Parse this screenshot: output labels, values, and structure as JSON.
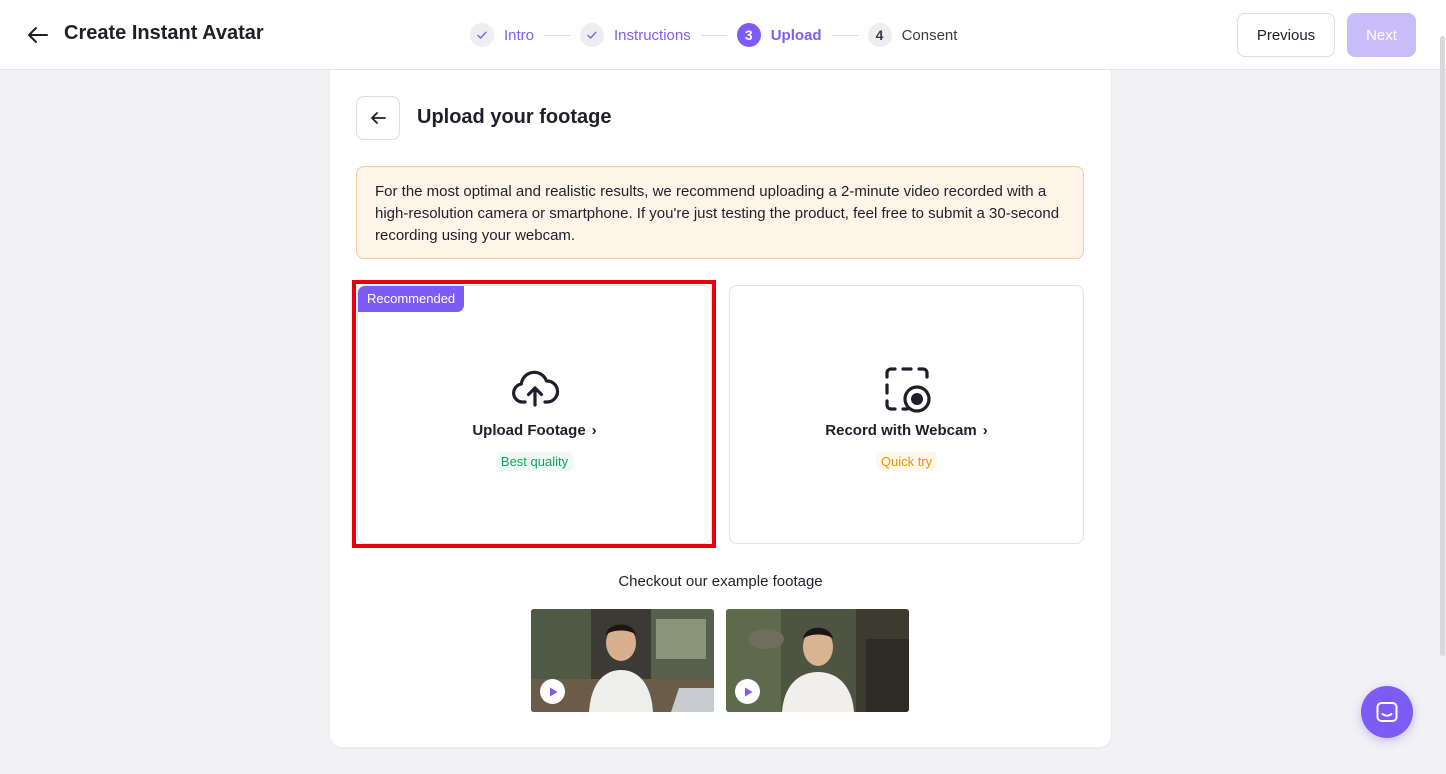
{
  "header": {
    "title": "Create Instant Avatar",
    "steps": [
      {
        "number": "1",
        "label": "Intro",
        "state": "done"
      },
      {
        "number": "2",
        "label": "Instructions",
        "state": "done"
      },
      {
        "number": "3",
        "label": "Upload",
        "state": "active"
      },
      {
        "number": "4",
        "label": "Consent",
        "state": "todo"
      }
    ],
    "previous_label": "Previous",
    "next_label": "Next"
  },
  "main": {
    "title": "Upload your footage",
    "notice": "For the most optimal and realistic results, we recommend uploading a 2-minute video recorded with a high-resolution camera or smartphone. If you're just testing the product, feel free to submit a 30-second recording using your webcam.",
    "options": [
      {
        "badge": "Recommended",
        "title": "Upload Footage",
        "tag": "Best quality",
        "icon": "cloud-upload-icon"
      },
      {
        "title": "Record with Webcam",
        "tag": "Quick try",
        "icon": "webcam-record-icon"
      }
    ],
    "examples_title": "Checkout our example footage"
  },
  "colors": {
    "accent": "#7c5cf4",
    "next_disabled": "#c9bdf9",
    "highlight": "#e8000f",
    "notice_bg": "#fff4e8"
  }
}
